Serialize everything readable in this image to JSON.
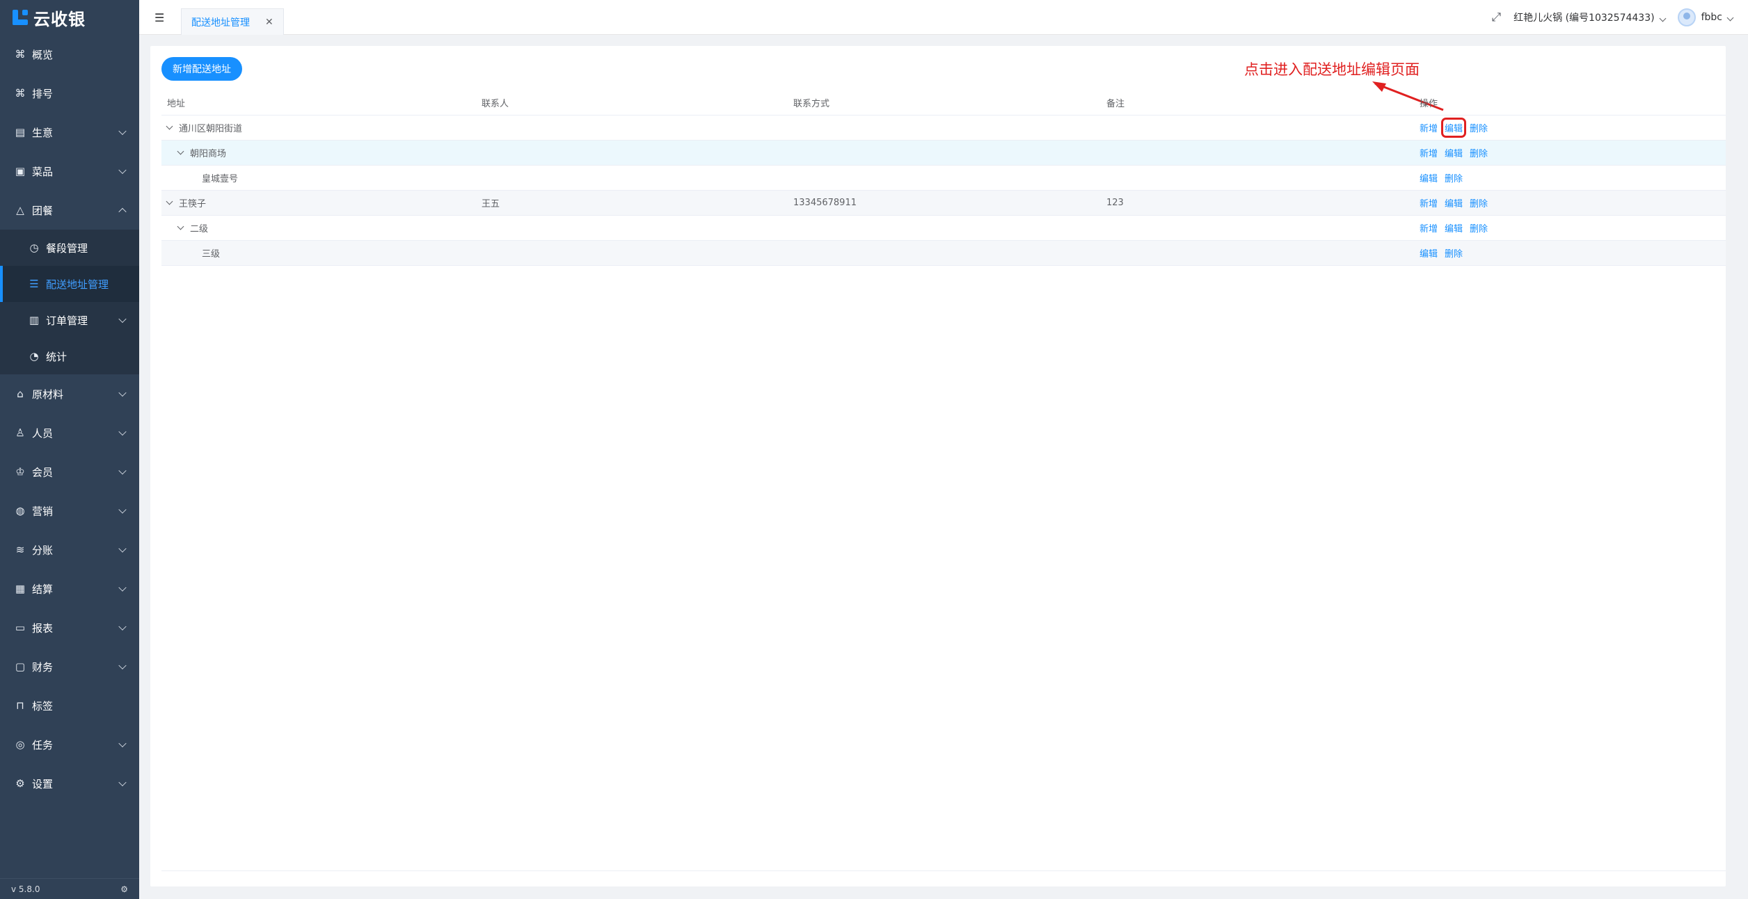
{
  "app": {
    "name": "云收银",
    "version": "v 5.8.0"
  },
  "sidebar": {
    "items": [
      {
        "label": "概览",
        "icon": "cluster-icon",
        "arrow": false
      },
      {
        "label": "排号",
        "icon": "cluster-icon",
        "arrow": false
      },
      {
        "label": "生意",
        "icon": "document-icon",
        "arrow": true
      },
      {
        "label": "菜品",
        "icon": "dish-icon",
        "arrow": true
      },
      {
        "label": "团餐",
        "icon": "triangle-icon",
        "arrow": true,
        "expanded": true
      },
      {
        "label": "原材料",
        "icon": "house-icon",
        "arrow": true
      },
      {
        "label": "人员",
        "icon": "users-icon",
        "arrow": true
      },
      {
        "label": "会员",
        "icon": "crown-icon",
        "arrow": true
      },
      {
        "label": "营销",
        "icon": "palette-icon",
        "arrow": true
      },
      {
        "label": "分账",
        "icon": "database-icon",
        "arrow": true
      },
      {
        "label": "结算",
        "icon": "settle-icon",
        "arrow": true
      },
      {
        "label": "报表",
        "icon": "board-icon",
        "arrow": true
      },
      {
        "label": "财务",
        "icon": "wallet-icon",
        "arrow": true
      },
      {
        "label": "标签",
        "icon": "bookmark-icon",
        "arrow": false
      },
      {
        "label": "任务",
        "icon": "compass-icon",
        "arrow": true
      },
      {
        "label": "设置",
        "icon": "gear-icon",
        "arrow": true
      }
    ],
    "sub": [
      {
        "label": "餐段管理",
        "icon": "clock-icon",
        "arrow": false
      },
      {
        "label": "配送地址管理",
        "icon": "list-icon",
        "arrow": false,
        "active": true
      },
      {
        "label": "订单管理",
        "icon": "clipboard-icon",
        "arrow": true
      },
      {
        "label": "统计",
        "icon": "pie-icon",
        "arrow": false
      }
    ]
  },
  "header": {
    "tab_label": "配送地址管理",
    "store": "红艳儿火锅 (编号1032574433)",
    "user": "fbbc"
  },
  "main": {
    "add_button": "新增配送地址",
    "annotation": "点击进入配送地址编辑页面",
    "columns": [
      "地址",
      "联系人",
      "联系方式",
      "备注",
      "操作"
    ],
    "actions": {
      "add": "新增",
      "edit": "编辑",
      "delete": "删除"
    },
    "rows": [
      {
        "address": "通川区朝阳街道",
        "contact": "",
        "phone": "",
        "note": ""
      },
      {
        "address": "朝阳商场",
        "contact": "",
        "phone": "",
        "note": ""
      },
      {
        "address": "皇城壹号",
        "contact": "",
        "phone": "",
        "note": ""
      },
      {
        "address": "王筷子",
        "contact": "王五",
        "phone": "13345678911",
        "note": "123"
      },
      {
        "address": "二级",
        "contact": "",
        "phone": "",
        "note": ""
      },
      {
        "address": "三级",
        "contact": "",
        "phone": "",
        "note": ""
      }
    ]
  }
}
